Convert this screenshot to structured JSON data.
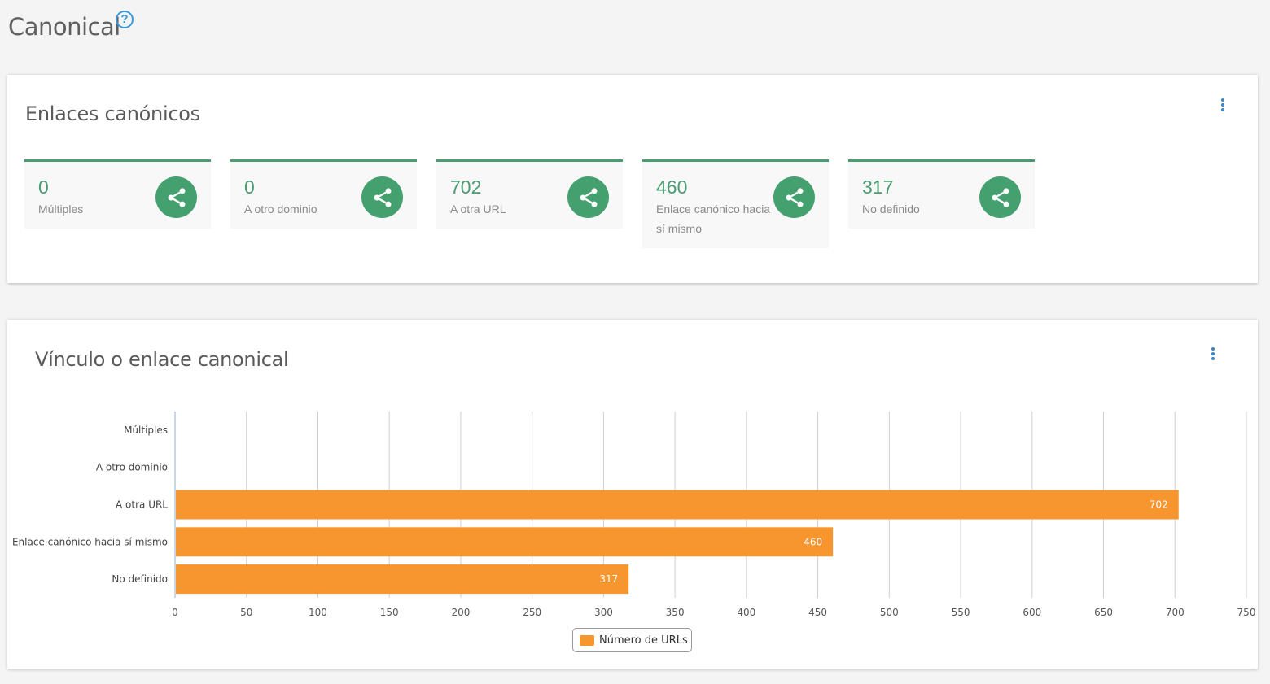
{
  "page": {
    "title": "Canonical",
    "help_symbol": "?"
  },
  "summary_panel": {
    "title": "Enlaces canónicos",
    "cards": [
      {
        "value": "0",
        "label": "Múltiples"
      },
      {
        "value": "0",
        "label": "A otro dominio"
      },
      {
        "value": "702",
        "label": "A otra URL"
      },
      {
        "value": "460",
        "label": "Enlace canónico hacia sí mismo"
      },
      {
        "value": "317",
        "label": "No definido"
      }
    ]
  },
  "chart_panel": {
    "title": "Vínculo o enlace canonical",
    "legend": "Número de URLs"
  },
  "colors": {
    "accent_green": "#4a9c72",
    "icon_green": "#45a06f",
    "bar_orange": "#f7962f",
    "link_blue": "#3a86c8"
  },
  "icons": {
    "card_icon": "share-icon",
    "menu_icon": "more-vertical-icon",
    "help_icon": "help-circle-icon"
  },
  "chart_data": {
    "type": "bar",
    "orientation": "horizontal",
    "title": "Vínculo o enlace canonical",
    "categories": [
      "Múltiples",
      "A otro dominio",
      "A otra URL",
      "Enlace canónico hacia sí mismo",
      "No definido"
    ],
    "series": [
      {
        "name": "Número de URLs",
        "values": [
          0,
          0,
          702,
          460,
          317
        ]
      }
    ],
    "xlim": [
      0,
      750
    ],
    "xticks": [
      0,
      50,
      100,
      150,
      200,
      250,
      300,
      350,
      400,
      450,
      500,
      550,
      600,
      650,
      700,
      750
    ],
    "grid": "vertical",
    "legend_position": "bottom-center",
    "data_labels": true
  }
}
